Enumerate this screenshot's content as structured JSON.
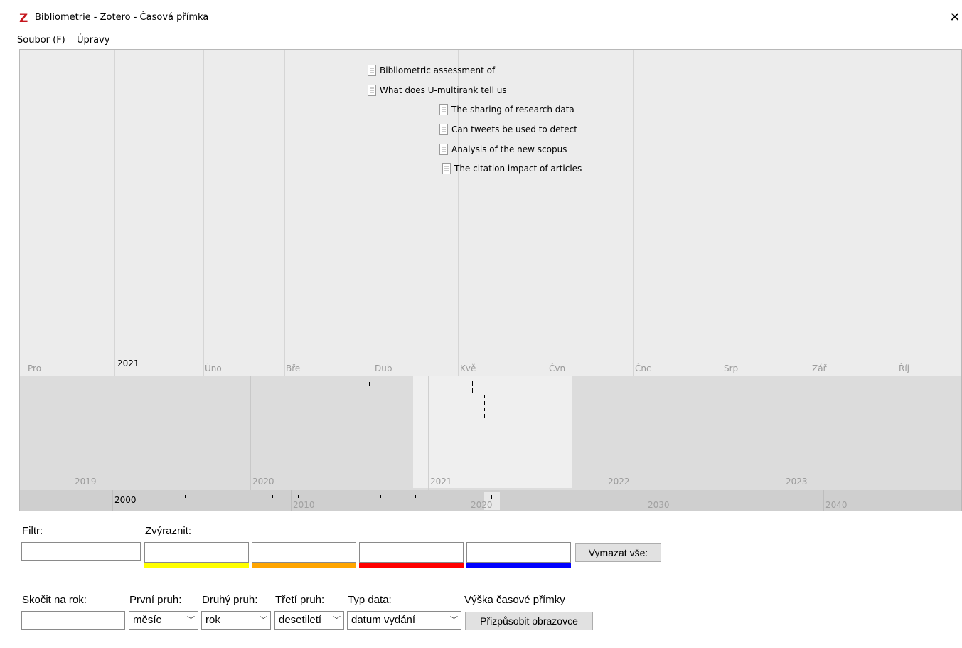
{
  "window": {
    "title": "Bibliometrie - Zotero - Časová přímka",
    "close_glyph": "✕"
  },
  "menu": {
    "file": "Soubor (F)",
    "edit": "Úpravy"
  },
  "timeline": {
    "band1_labels": [
      "Pro",
      "2021",
      "Úno",
      "Bře",
      "Dub",
      "Kvě",
      "Čvn",
      "Čnc",
      "Srp",
      "Zář",
      "Říj"
    ],
    "events": [
      "Bibliometric assessment of",
      "What does U-multirank tell us",
      "The sharing of research data",
      "Can tweets be used to detect",
      "Analysis of the new scopus",
      "The citation impact of articles"
    ],
    "band2_labels": [
      "2019",
      "2020",
      "2021",
      "2022",
      "2023"
    ],
    "band3_labels": [
      "2000",
      "2010",
      "2020",
      "2030",
      "2040"
    ]
  },
  "filter": {
    "filter_label": "Filtr:",
    "highlight_label": "Zvýraznit:",
    "filter_value": "",
    "highlight_colors": [
      "#ffff00",
      "#ffa500",
      "#ff0000",
      "#0000ff"
    ],
    "clear_all": "Vymazat vše:"
  },
  "controls": {
    "jump_label": "Skočit na rok:",
    "jump_value": "",
    "band1_label": "První pruh:",
    "band1_value": "měsíc",
    "band2_label": "Druhý pruh:",
    "band2_value": "rok",
    "band3_label": "Třetí pruh:",
    "band3_value": "desetiletí",
    "date_type_label": "Typ data:",
    "date_type_value": "datum vydání",
    "height_label": "Výška časové přímky",
    "fit_button": "Přizpůsobit obrazovce"
  }
}
